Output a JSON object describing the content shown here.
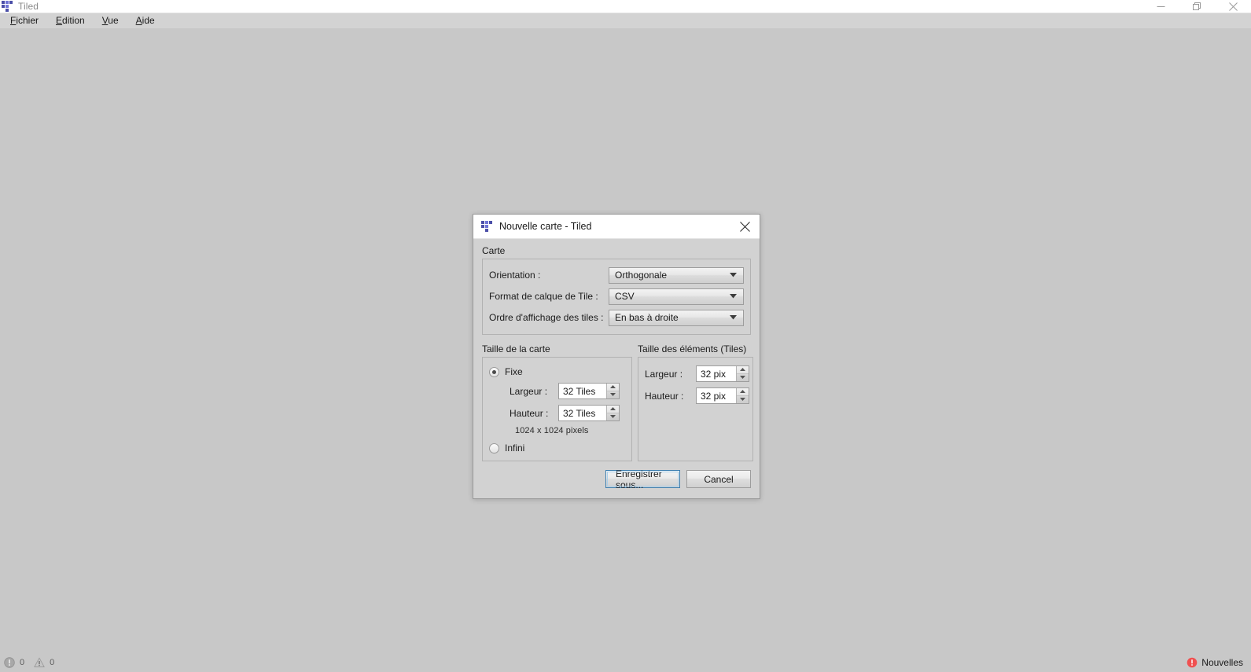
{
  "app": {
    "title": "Tiled",
    "logo_icon": "tiled-logo-icon",
    "window_controls": {
      "minimize": "minimize-icon",
      "restore": "restore-icon",
      "close": "close-icon"
    }
  },
  "menubar": {
    "items": [
      {
        "label": "Fichier",
        "mnemonic": "F",
        "rest": "ichier"
      },
      {
        "label": "Edition",
        "mnemonic": "E",
        "rest": "dition"
      },
      {
        "label": "Vue",
        "mnemonic": "V",
        "rest": "ue"
      },
      {
        "label": "Aide",
        "mnemonic": "A",
        "rest": "ide"
      }
    ]
  },
  "statusbar": {
    "error_icon": "error-icon",
    "error_count": "0",
    "warning_icon": "warning-icon",
    "warning_count": "0",
    "news_icon": "news-alert-icon",
    "news_label": "Nouvelles",
    "news_color": "#f05050"
  },
  "dialog": {
    "title": "Nouvelle carte - Tiled",
    "logo_icon": "tiled-logo-icon",
    "close_icon": "close-icon",
    "carte": {
      "group_title": "Carte",
      "fields": [
        {
          "label": "Orientation :",
          "value": "Orthogonale",
          "arrow_icon": "chevron-down-icon"
        },
        {
          "label": "Format de calque de Tile :",
          "value": "CSV",
          "arrow_icon": "chevron-down-icon"
        },
        {
          "label": "Ordre d'affichage des tiles :",
          "value": "En bas à droite",
          "arrow_icon": "chevron-down-icon"
        }
      ]
    },
    "map_size": {
      "group_title": "Taille de la carte",
      "radio_fixed": {
        "label": "Fixe",
        "selected": true
      },
      "radio_infinite": {
        "label": "Infini",
        "selected": false
      },
      "width": {
        "label": "Largeur :",
        "value": "32 Tiles"
      },
      "height": {
        "label": "Hauteur :",
        "value": "32 Tiles"
      },
      "pixel_note": "1024 x 1024 pixels"
    },
    "tile_size": {
      "group_title": "Taille des éléments (Tiles)",
      "width": {
        "label": "Largeur :",
        "value": "32 pix"
      },
      "height": {
        "label": "Hauteur :",
        "value": "32 pix"
      }
    },
    "buttons": {
      "save": "Enregistrer sous...",
      "cancel": "Cancel",
      "focus_color": "#3c7fb1"
    }
  }
}
